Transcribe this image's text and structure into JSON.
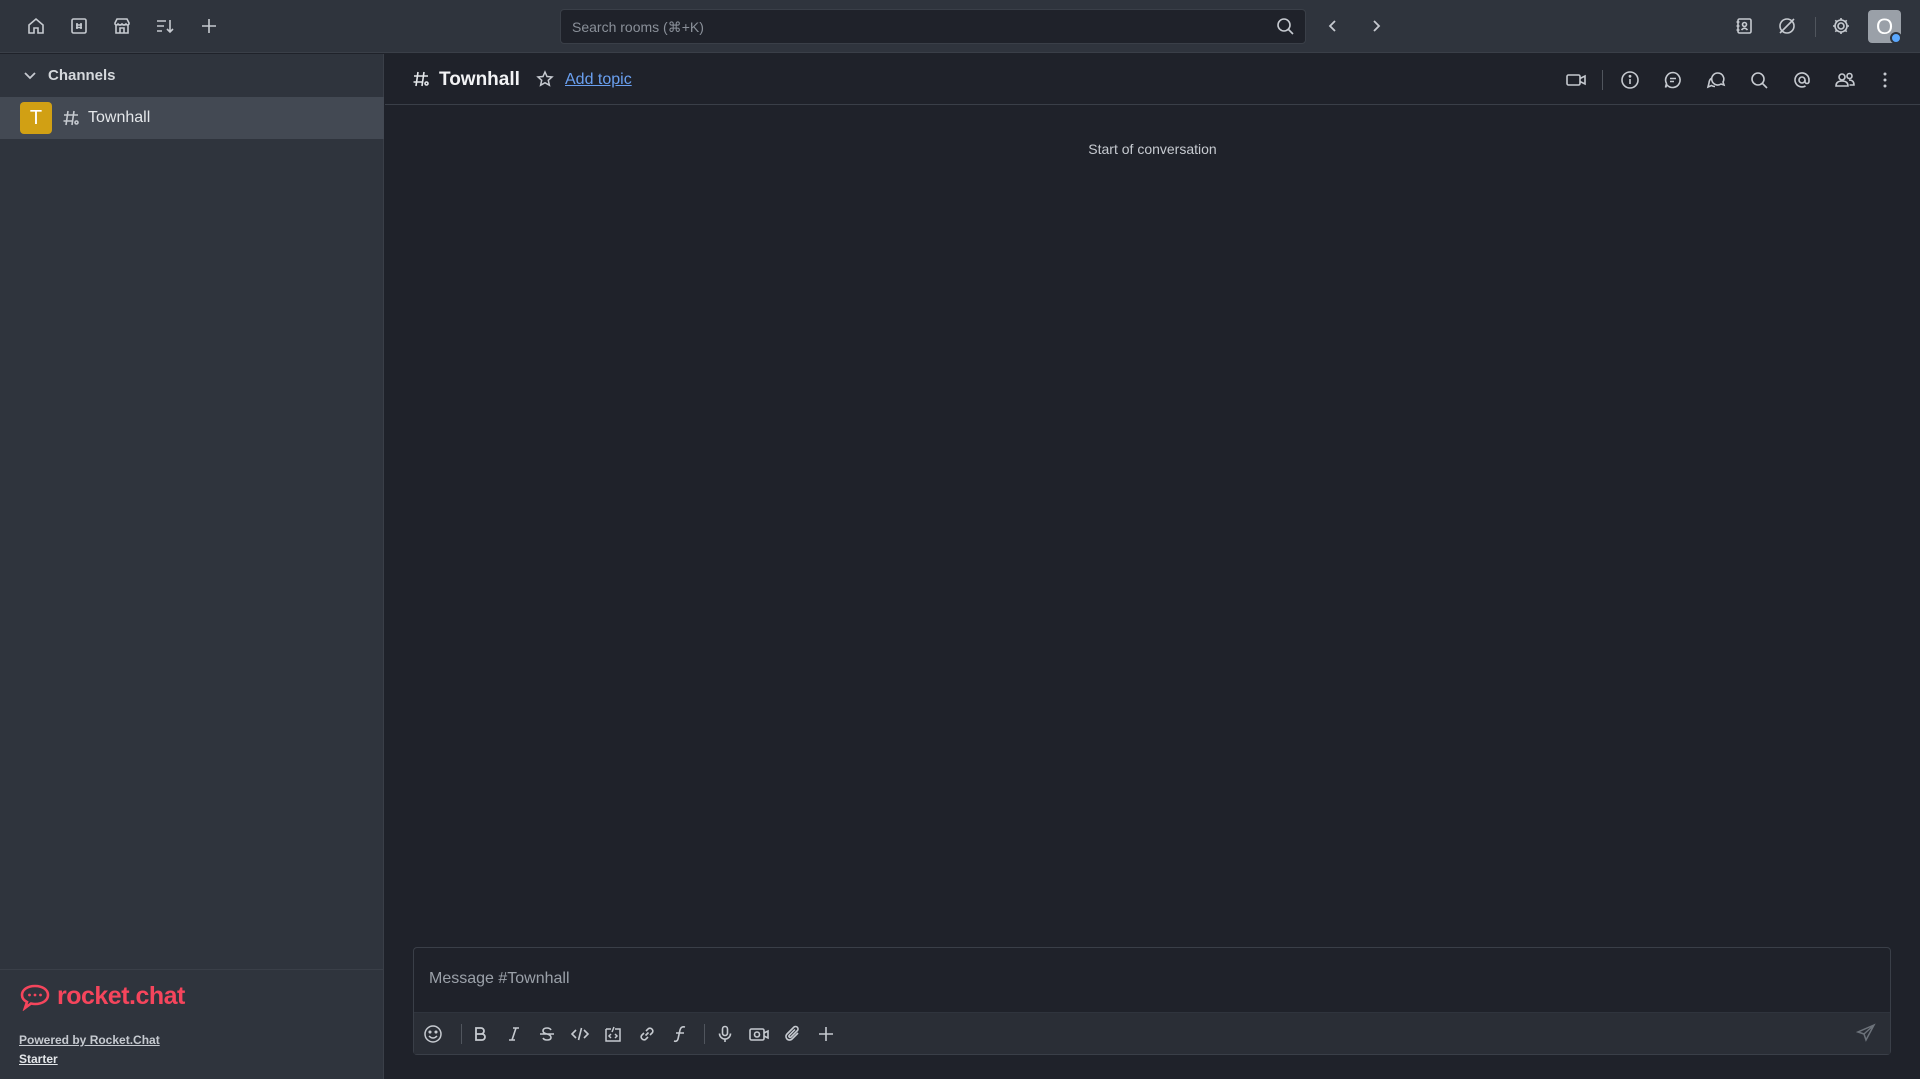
{
  "topbar": {
    "search_placeholder": "Search rooms (⌘+K)",
    "user_initial": "O"
  },
  "sidebar": {
    "group_label": "Channels",
    "rooms": [
      {
        "avatar_letter": "T",
        "label": "Townhall",
        "avatar_color": "#d1a014"
      }
    ],
    "footer": {
      "brand": "rocket.chat",
      "powered_by": "Powered by Rocket.Chat",
      "plan": "Starter"
    }
  },
  "room": {
    "title": "Townhall",
    "add_topic": "Add topic",
    "start_of_conversation": "Start of conversation"
  },
  "composer": {
    "placeholder": "Message #Townhall"
  },
  "colors": {
    "accent_link": "#6aa0f0",
    "brand": "#f5455c",
    "status_online": "#5ba8ff"
  }
}
